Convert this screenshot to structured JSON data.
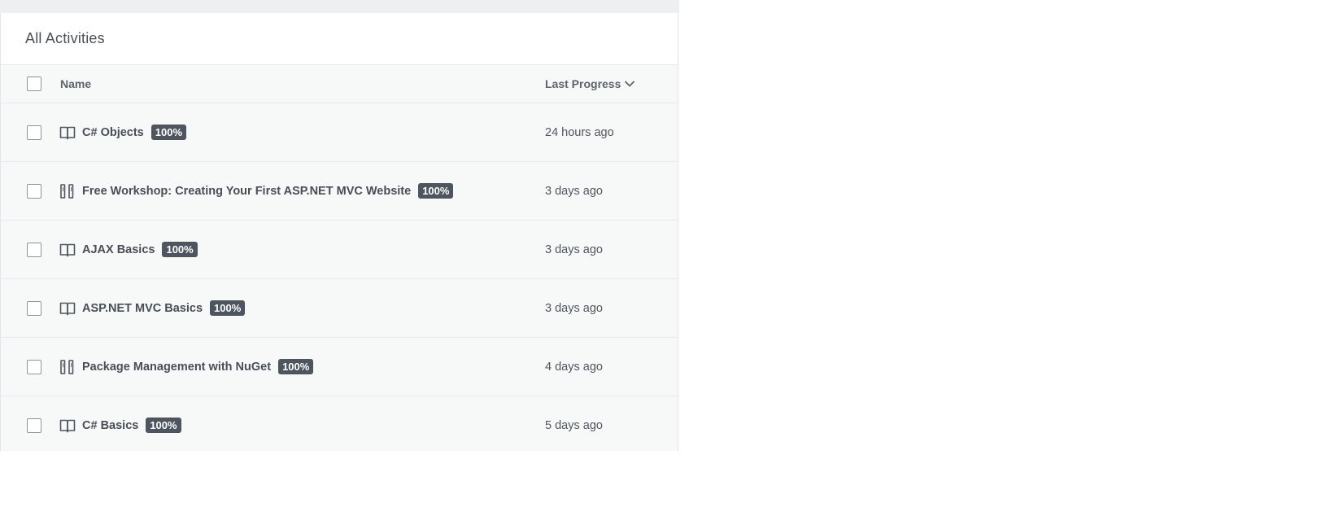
{
  "panel": {
    "title": "All Activities"
  },
  "table": {
    "columns": {
      "name": "Name",
      "last_progress": "Last Progress"
    },
    "rows": [
      {
        "icon": "book-icon",
        "title": "C# Objects",
        "badge": "100%",
        "time": "24 hours ago"
      },
      {
        "icon": "workshop-icon",
        "title": "Free Workshop: Creating Your First ASP.NET MVC Website",
        "badge": "100%",
        "time": "3 days ago"
      },
      {
        "icon": "book-icon",
        "title": "AJAX Basics",
        "badge": "100%",
        "time": "3 days ago"
      },
      {
        "icon": "book-icon",
        "title": "ASP.NET MVC Basics",
        "badge": "100%",
        "time": "3 days ago"
      },
      {
        "icon": "workshop-icon",
        "title": "Package Management with NuGet",
        "badge": "100%",
        "time": "4 days ago"
      },
      {
        "icon": "book-icon",
        "title": "C# Basics",
        "badge": "100%",
        "time": "5 days ago"
      }
    ]
  }
}
